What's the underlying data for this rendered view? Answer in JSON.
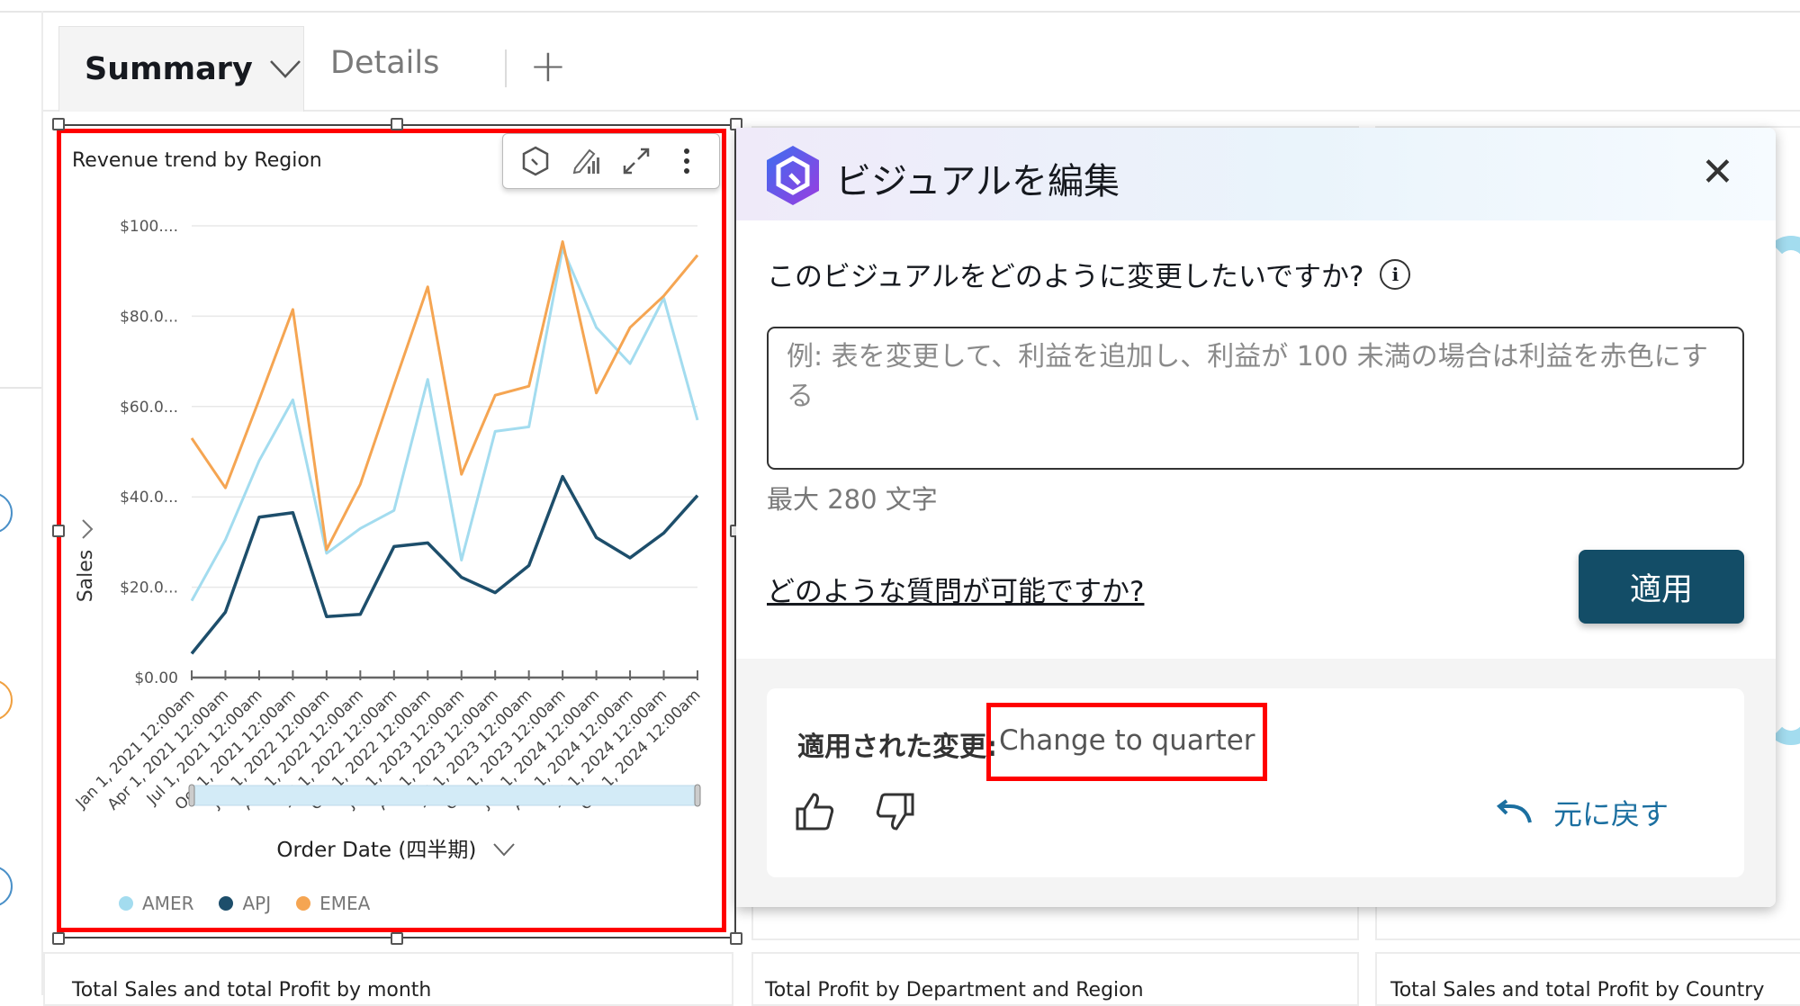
{
  "tabs": [
    {
      "label": "Summary",
      "active": true
    },
    {
      "label": "Details",
      "active": false
    }
  ],
  "add_tab_label": "+",
  "background_cards": [
    {
      "title": "Total Sales and total Profit by month"
    },
    {
      "title": "Total Profit by Department and Region"
    },
    {
      "title": "Total Sales and total Profit by Country"
    }
  ],
  "visual": {
    "toolbar_icons": [
      "q-hexagon-icon",
      "edit-chart-icon",
      "expand-icon",
      "more-vertical-icon"
    ]
  },
  "chart_data": {
    "type": "line",
    "title": "Revenue trend by Region",
    "xlabel": "Order Date (四半期)",
    "ylabel": "Sales",
    "y_tick_labels": [
      "$0.00",
      "$20.0...",
      "$40.0...",
      "$60.0...",
      "$80.0...",
      "$100...."
    ],
    "ylim": [
      0,
      100
    ],
    "grid": true,
    "legend_position": "bottom-left",
    "x": [
      "Jan 1, 2021 12:00am",
      "Apr 1, 2021 12:00am",
      "Jul 1, 2021 12:00am",
      "Oct 1, 2021 12:00am",
      "Jan 1, 2022 12:00am",
      "Apr 1, 2022 12:00am",
      "Jul 1, 2022 12:00am",
      "Oct 1, 2022 12:00am",
      "Jan 1, 2023 12:00am",
      "Apr 1, 2023 12:00am",
      "Jul 1, 2023 12:00am",
      "Oct 1, 2023 12:00am",
      "Jan 1, 2024 12:00am",
      "Apr 1, 2024 12:00am",
      "Jul 1, 2024 12:00am",
      "Oct 1, 2024 12:00am"
    ],
    "series": [
      {
        "name": "AMER",
        "color": "#a3dcef",
        "values": [
          17,
          30.5,
          48,
          61.5,
          27.5,
          33,
          37,
          66,
          26,
          54.5,
          55.5,
          95,
          77.5,
          69.5,
          84,
          57
        ]
      },
      {
        "name": "APJ",
        "color": "#1d4e6b",
        "values": [
          5.3,
          14.5,
          35.5,
          36.5,
          13.5,
          14,
          29,
          29.8,
          22.2,
          18.8,
          24.8,
          44.5,
          31,
          26.5,
          32,
          40.3
        ]
      },
      {
        "name": "EMEA",
        "color": "#f5a552",
        "values": [
          53,
          42,
          61.5,
          81.5,
          28.3,
          42.8,
          64.8,
          86.5,
          45,
          62.5,
          64.5,
          96.5,
          63,
          77.5,
          84.5,
          93.5
        ]
      }
    ]
  },
  "panel": {
    "title": "ビジュアルを編集",
    "question": "このビジュアルをどのように変更したいですか?",
    "placeholder": "例: 表を変更して、利益を追加し、利益が 100 未満の場合は利益を赤色にする",
    "prompt_value": "",
    "max_chars": "最大 280 文字",
    "help_link": "どのような質問が可能ですか?",
    "apply_label": "適用",
    "applied_label": "適用された変更:",
    "applied_value": "Change to quarter",
    "undo_label": "元に戻す",
    "brand_colors": {
      "apply": "#134d67",
      "undo": "#1b6fa0",
      "highlight": "#ff0000"
    }
  }
}
